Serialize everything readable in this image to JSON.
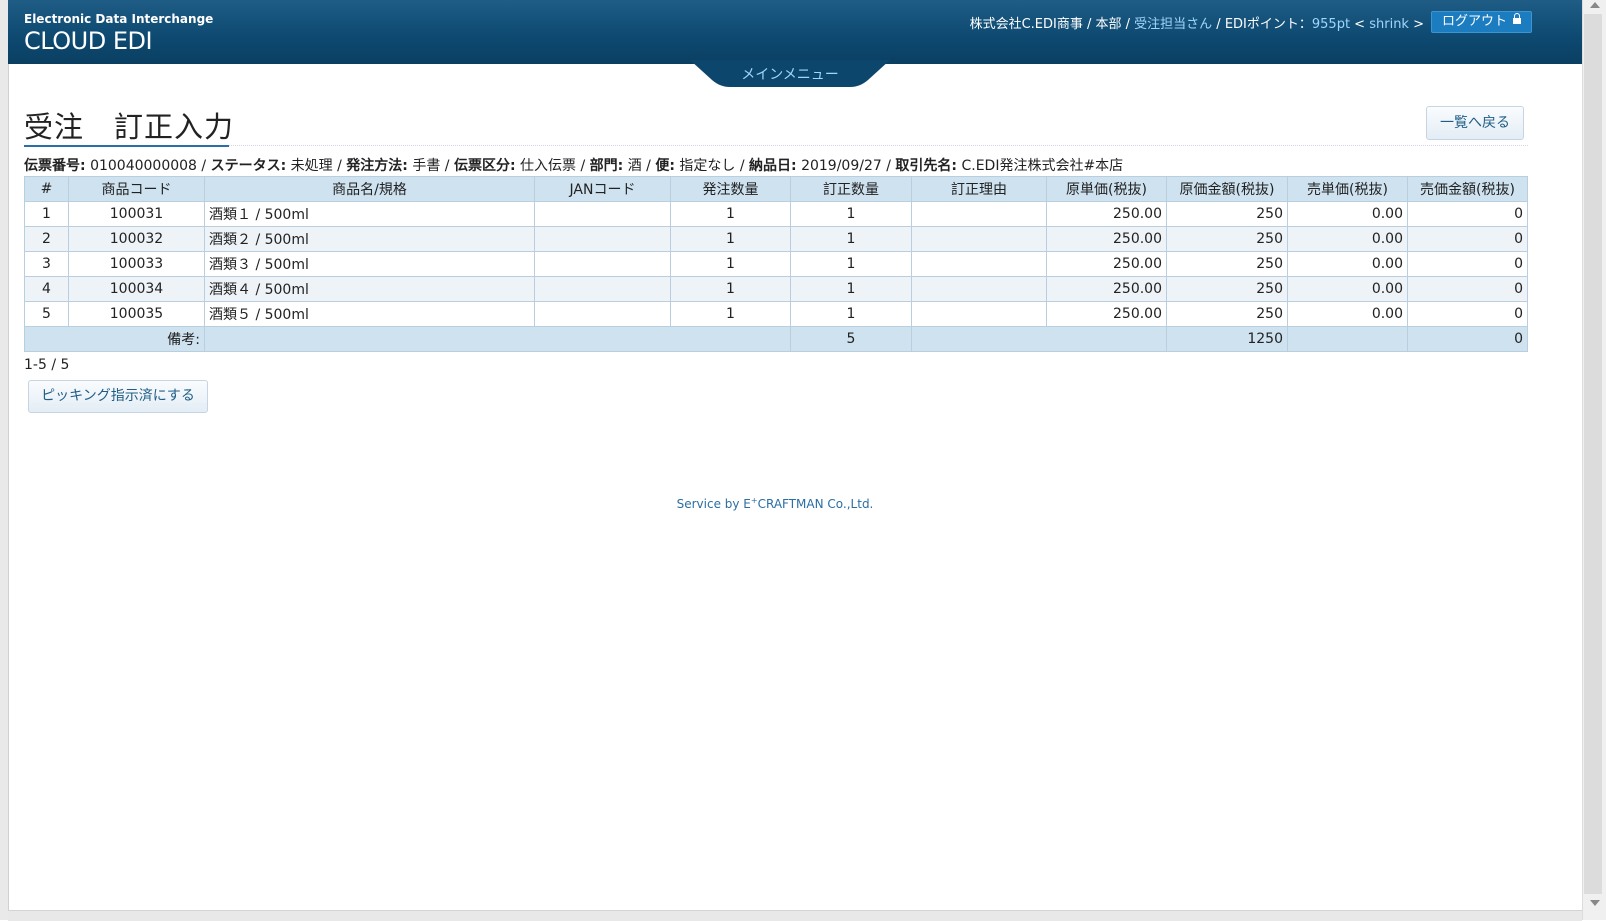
{
  "header": {
    "brand_sub": "Electronic Data Interchange",
    "brand_main": "CLOUD EDI",
    "company": "株式会社C.EDI商事 / 本部 / ",
    "user_link": "受注担当さん",
    "points_label": " / EDIポイント：",
    "points_value": "955pt",
    "shrink_open": " < ",
    "shrink_link": "shrink",
    "shrink_close": " >",
    "logout_label": "ログアウト"
  },
  "menu": {
    "main_menu_label": "メインメニュー"
  },
  "page": {
    "title": "受注　訂正入力",
    "back_label": "一覧へ戻る"
  },
  "info": {
    "slip_no_label": "伝票番号:",
    "slip_no": "010040000008",
    "status_label": "ステータス:",
    "status": "未処理",
    "method_label": "発注方法:",
    "method": "手書",
    "slip_type_label": "伝票区分:",
    "slip_type": "仕入伝票",
    "dept_label": "部門:",
    "dept": "酒",
    "flight_label": "便:",
    "flight": "指定なし",
    "delivery_label": "納品日:",
    "delivery": "2019/09/27",
    "partner_label": "取引先名:",
    "partner": "C.EDI発注株式会社#本店",
    "sep": " / "
  },
  "table": {
    "headers": [
      "#",
      "商品コード",
      "商品名/規格",
      "JANコード",
      "発注数量",
      "訂正数量",
      "訂正理由",
      "原単価(税抜)",
      "原価金額(税抜)",
      "売単価(税抜)",
      "売価金額(税抜)"
    ],
    "rows": [
      [
        "1",
        "100031",
        "酒類１ / 500ml",
        "",
        "1",
        "1",
        "",
        "250.00",
        "250",
        "0.00",
        "0"
      ],
      [
        "2",
        "100032",
        "酒類２ / 500ml",
        "",
        "1",
        "1",
        "",
        "250.00",
        "250",
        "0.00",
        "0"
      ],
      [
        "3",
        "100033",
        "酒類３ / 500ml",
        "",
        "1",
        "1",
        "",
        "250.00",
        "250",
        "0.00",
        "0"
      ],
      [
        "4",
        "100034",
        "酒類４ / 500ml",
        "",
        "1",
        "1",
        "",
        "250.00",
        "250",
        "0.00",
        "0"
      ],
      [
        "5",
        "100035",
        "酒類５ / 500ml",
        "",
        "1",
        "1",
        "",
        "250.00",
        "250",
        "0.00",
        "0"
      ]
    ],
    "footer": {
      "remarks_label": "備考:",
      "total_qty": "5",
      "total_cost": "1250",
      "total_sales": "0"
    }
  },
  "pager": "1-5 / 5",
  "actions": {
    "picking_label": "ピッキング指示済にする"
  },
  "footer": {
    "credit_prefix": "Service by E",
    "credit_sup": "+",
    "credit_suffix": "CRAFTMAN Co.,Ltd."
  }
}
